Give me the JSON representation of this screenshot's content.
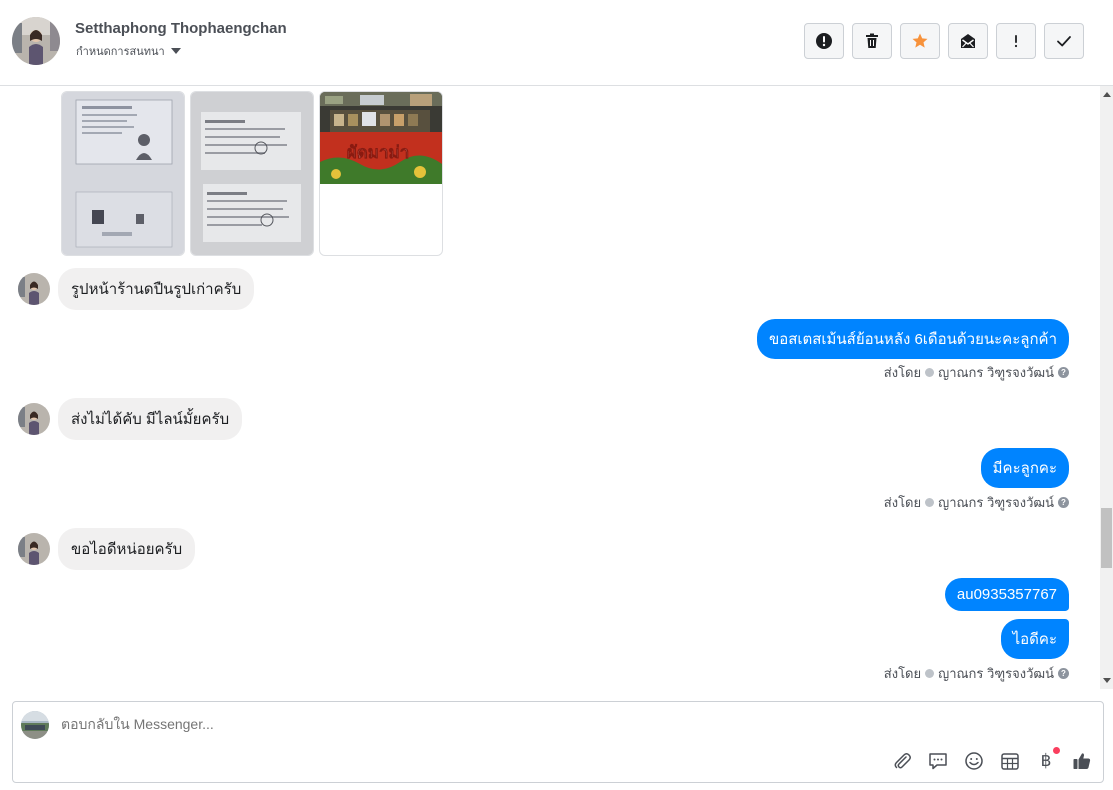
{
  "header": {
    "contact_name": "Setthaphong Thophaengchan",
    "subtitle": "กำหนดการสนทนา",
    "toolbar": [
      {
        "name": "alert-icon",
        "label": "!"
      },
      {
        "name": "trash-icon",
        "label": ""
      },
      {
        "name": "star-icon",
        "label": ""
      },
      {
        "name": "mail-icon",
        "label": ""
      },
      {
        "name": "exclamation-icon",
        "label": "!"
      },
      {
        "name": "check-icon",
        "label": ""
      }
    ]
  },
  "conversation": {
    "photos": [
      "id-card-photo",
      "document-photo",
      "shop-photo"
    ],
    "shop_photo_text": "ผัดมาม่า",
    "messages": [
      {
        "direction": "in",
        "text": "รูปหน้าร้านดปืนรูปเก่าครับ"
      },
      {
        "direction": "out",
        "texts": [
          "ขอสเตสเม้นส์ย้อนหลัง 6เดือนด้วยนะคะลูกค้า"
        ],
        "sent_by_label": "ส่งโดย",
        "sender": "ญาณกร วิฑูรจงวัฒน์"
      },
      {
        "direction": "in",
        "text": "ส่งไม่ได้คับ มีไลน์มั้ยครับ"
      },
      {
        "direction": "out",
        "texts": [
          "มีคะลูกคะ"
        ],
        "sent_by_label": "ส่งโดย",
        "sender": "ญาณกร วิฑูรจงวัฒน์"
      },
      {
        "direction": "in",
        "text": "ขอไอดีหน่อยครับ"
      },
      {
        "direction": "out",
        "texts": [
          "au0935357767",
          "ไอดีคะ"
        ],
        "sent_by_label": "ส่งโดย",
        "sender": "ญาณกร วิฑูรจงวัฒน์"
      }
    ]
  },
  "composer": {
    "placeholder": "ตอบกลับใน Messenger...",
    "tools": [
      "attachment-icon",
      "saved-reply-icon",
      "emoji-icon",
      "calendar-icon",
      "baht-payment-icon",
      "thumbs-up-icon"
    ],
    "baht_symbol": "฿"
  },
  "colors": {
    "accent": "#0084ff",
    "incoming_bubble": "#f1f0f0",
    "star": "#f7923b",
    "notification": "#fa3e5e"
  }
}
